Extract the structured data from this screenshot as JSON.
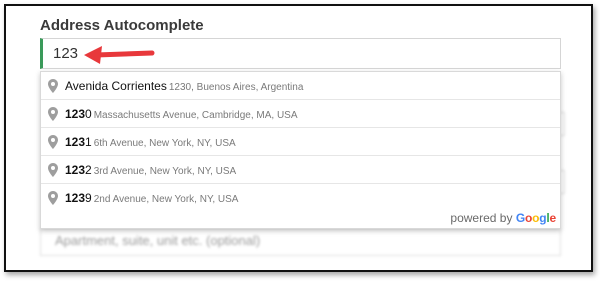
{
  "form": {
    "title": "Address Autocomplete",
    "input_value": "123",
    "background_placeholder": "Apartment, suite, unit etc. (optional)"
  },
  "suggestions": [
    {
      "match": "",
      "rest": "Avenida Corrientes",
      "secondary": "1230, Buenos Aires, Argentina"
    },
    {
      "match": "123",
      "rest": "0",
      "secondary": "Massachusetts Avenue, Cambridge, MA, USA"
    },
    {
      "match": "123",
      "rest": "1",
      "secondary": "6th Avenue, New York, NY, USA"
    },
    {
      "match": "123",
      "rest": "2",
      "secondary": "3rd Avenue, New York, NY, USA"
    },
    {
      "match": "123",
      "rest": "9",
      "secondary": "2nd Avenue, New York, NY, USA"
    }
  ],
  "attribution": {
    "prefix": "powered by",
    "letters": [
      "G",
      "o",
      "o",
      "g",
      "l",
      "e"
    ]
  },
  "colors": {
    "arrow": "#e8383b",
    "input_accent": "#3a9a5a",
    "pin": "#9e9e9e"
  },
  "icons": {
    "arrow": "red-arrow-icon",
    "pin": "map-pin-icon"
  }
}
